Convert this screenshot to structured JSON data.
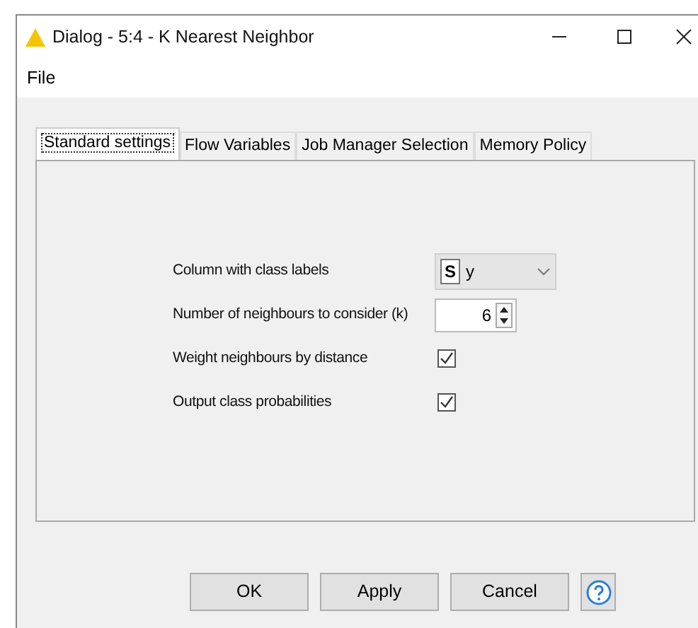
{
  "window": {
    "title": "Dialog - 5:4 - K Nearest Neighbor"
  },
  "menu": [
    "File"
  ],
  "tabs": [
    {
      "label": "Standard settings",
      "selected": true
    },
    {
      "label": "Flow Variables",
      "selected": false
    },
    {
      "label": "Job Manager Selection",
      "selected": false
    },
    {
      "label": "Memory Policy",
      "selected": false
    }
  ],
  "settings": [
    {
      "kind": "column",
      "label": "Column with class labels",
      "type_badge": "S",
      "value": "y"
    },
    {
      "kind": "spinner",
      "label": "Number of neighbours to consider (k)",
      "value": "6"
    },
    {
      "kind": "checkbox",
      "label": "Weight neighbours by distance",
      "checked": true
    },
    {
      "kind": "checkbox",
      "label": "Output class probabilities",
      "checked": true
    }
  ],
  "buttons": [
    "OK",
    "Apply",
    "Cancel"
  ]
}
